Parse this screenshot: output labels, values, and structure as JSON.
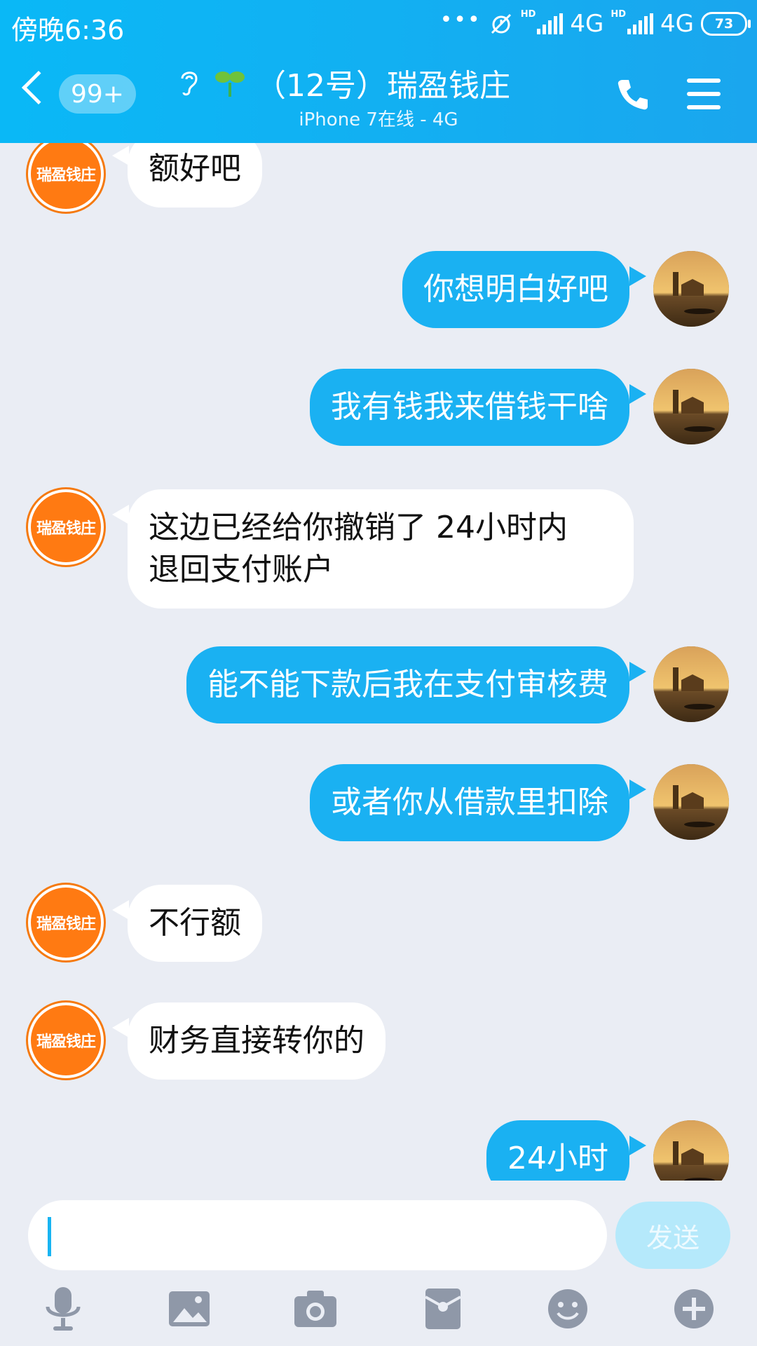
{
  "status_bar": {
    "time": "傍晚6:36",
    "network_1": "4G",
    "network_2": "4G",
    "battery": "73",
    "hd_label": "HD"
  },
  "header": {
    "unread_count": "99+",
    "title": "（12号）瑞盈钱庄",
    "subtitle": "iPhone 7在线 - 4G"
  },
  "contact_avatar_text": "瑞盈钱庄",
  "messages": [
    {
      "side": "in",
      "text": "额好吧"
    },
    {
      "side": "out",
      "text": "你想明白好吧"
    },
    {
      "side": "out",
      "text": "我有钱我来借钱干啥"
    },
    {
      "side": "in",
      "text_lines": [
        "这边已经给你撤销了 24小时内",
        "退回支付账户"
      ]
    },
    {
      "side": "out",
      "text": "能不能下款后我在支付审核费"
    },
    {
      "side": "out",
      "text": "或者你从借款里扣除"
    },
    {
      "side": "in",
      "text": "不行额"
    },
    {
      "side": "in",
      "text": "财务直接转你的"
    },
    {
      "side": "out",
      "text": "24小时"
    }
  ],
  "input": {
    "value": "",
    "send_label": "发送"
  },
  "toolbar": [
    "mic-icon",
    "image-icon",
    "camera-icon",
    "red-packet-icon",
    "emoji-icon",
    "plus-icon"
  ],
  "colors": {
    "header": "#12b0f2",
    "outgoing_bubble": "#1ab1f2",
    "incoming_bubble": "#ffffff",
    "background": "#eaedf4",
    "contact_avatar": "#ff7a12",
    "send_button": "#b5e9fb"
  }
}
